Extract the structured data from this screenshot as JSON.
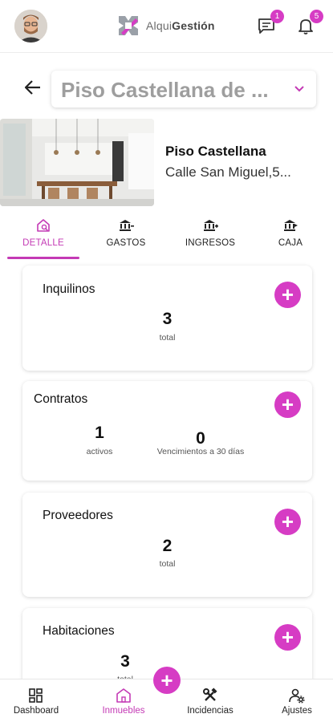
{
  "header": {
    "logo_part1": "Alqui",
    "logo_part2": "Gestión",
    "messages_badge": "1",
    "notifications_badge": "5",
    "brand_color": "#d63cc4"
  },
  "property": {
    "selector_text": "Piso Castellana de ...",
    "name": "Piso Castellana",
    "address": "Calle San Miguel,5..."
  },
  "tabs": [
    {
      "label": "DETALLE",
      "icon": "home-search-icon",
      "active": true
    },
    {
      "label": "GASTOS",
      "icon": "bank-minus-icon",
      "active": false
    },
    {
      "label": "INGRESOS",
      "icon": "bank-plus-icon",
      "active": false
    },
    {
      "label": "CAJA",
      "icon": "bank-transfer-icon",
      "active": false
    }
  ],
  "cards": {
    "inquilinos": {
      "title": "Inquilinos",
      "value": "3",
      "label": "total"
    },
    "contratos": {
      "title": "Contratos",
      "active_value": "1",
      "active_label": "activos",
      "expiring_value": "0",
      "expiring_label": "Vencimientos a 30 días"
    },
    "proveedores": {
      "title": "Proveedores",
      "value": "2",
      "label": "total"
    },
    "habitaciones": {
      "title": "Habitaciones",
      "value": "3",
      "label": "total"
    }
  },
  "plus_symbol": "+",
  "bottom_nav": [
    {
      "label": "Dashboard",
      "icon": "dashboard-icon",
      "active": false
    },
    {
      "label": "Inmuebles",
      "icon": "building-icon",
      "active": true
    },
    {
      "label": "Incidencias",
      "icon": "tools-icon",
      "active": false
    },
    {
      "label": "Ajustes",
      "icon": "user-settings-icon",
      "active": false
    }
  ]
}
